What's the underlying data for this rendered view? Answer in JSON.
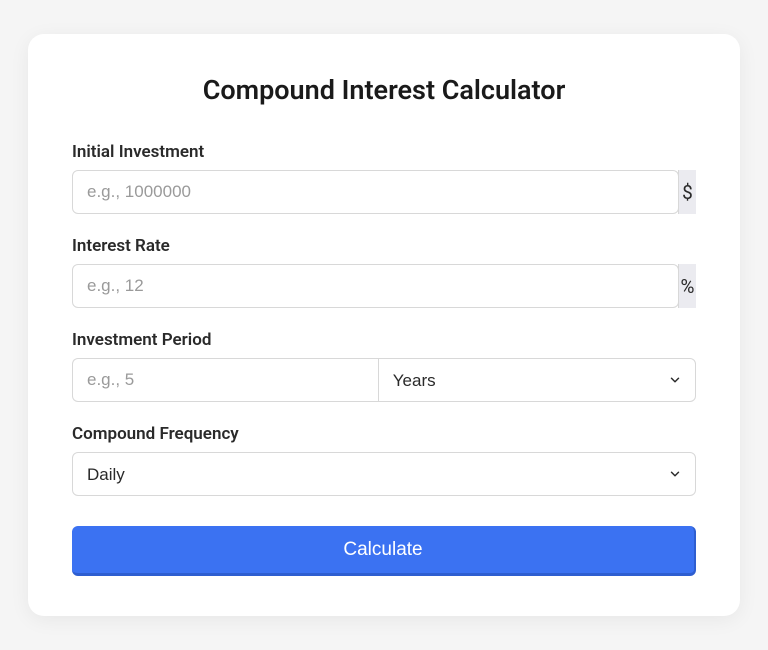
{
  "title": "Compound Interest Calculator",
  "fields": {
    "initial": {
      "label": "Initial Investment",
      "placeholder": "e.g., 1000000",
      "suffix": "$",
      "value": ""
    },
    "rate": {
      "label": "Interest Rate",
      "placeholder": "e.g., 12",
      "suffix": "%",
      "value": ""
    },
    "period": {
      "label": "Investment Period",
      "placeholder": "e.g., 5",
      "value": "",
      "unit_selected": "Years"
    },
    "frequency": {
      "label": "Compound Frequency",
      "selected": "Daily"
    }
  },
  "button": {
    "calculate": "Calculate"
  }
}
